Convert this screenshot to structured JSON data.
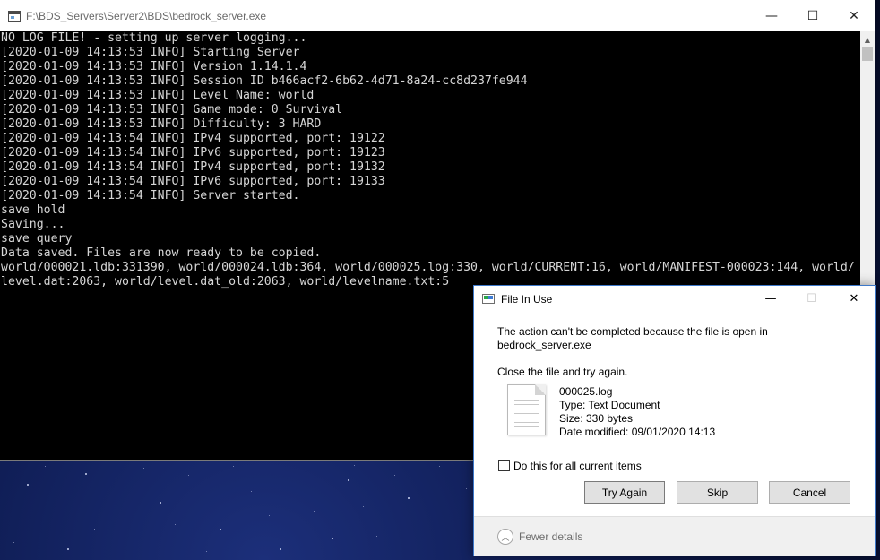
{
  "console": {
    "title": "F:\\BDS_Servers\\Server2\\BDS\\bedrock_server.exe",
    "lines": [
      "NO LOG FILE! - setting up server logging...",
      "[2020-01-09 14:13:53 INFO] Starting Server",
      "[2020-01-09 14:13:53 INFO] Version 1.14.1.4",
      "[2020-01-09 14:13:53 INFO] Session ID b466acf2-6b62-4d71-8a24-cc8d237fe944",
      "[2020-01-09 14:13:53 INFO] Level Name: world",
      "[2020-01-09 14:13:53 INFO] Game mode: 0 Survival",
      "[2020-01-09 14:13:53 INFO] Difficulty: 3 HARD",
      "[2020-01-09 14:13:54 INFO] IPv4 supported, port: 19122",
      "[2020-01-09 14:13:54 INFO] IPv6 supported, port: 19123",
      "[2020-01-09 14:13:54 INFO] IPv4 supported, port: 19132",
      "[2020-01-09 14:13:54 INFO] IPv6 supported, port: 19133",
      "[2020-01-09 14:13:54 INFO] Server started.",
      "save hold",
      "Saving...",
      "save query",
      "Data saved. Files are now ready to be copied.",
      "world/000021.ldb:331390, world/000024.ldb:364, world/000025.log:330, world/CURRENT:16, world/MANIFEST-000023:144, world/",
      "level.dat:2063, world/level.dat_old:2063, world/levelname.txt:5"
    ],
    "controls": {
      "minimize": "—",
      "maximize": "☐",
      "close": "✕"
    },
    "scrollbar": {
      "up": "▲",
      "down": "▼"
    }
  },
  "dialog": {
    "title": "File In Use",
    "controls": {
      "minimize": "—",
      "maximize": "☐",
      "close": "✕"
    },
    "message_line1": "The action can't be completed because the file is open in",
    "message_line2": "bedrock_server.exe",
    "instruction": "Close the file and try again.",
    "file": {
      "name": "000025.log",
      "type": "Type: Text Document",
      "size": "Size: 330 bytes",
      "date_modified": "Date modified: 09/01/2020 14:13"
    },
    "checkbox_label": "Do this for all current items",
    "checkbox_checked": false,
    "buttons": {
      "try_again": "Try Again",
      "skip": "Skip",
      "cancel": "Cancel"
    },
    "fewer_details": "Fewer details"
  },
  "colors": {
    "console_bg": "#000000",
    "console_text": "#d6d6d6",
    "dialog_border": "#3d78c9",
    "desktop_bg": "#0b1640"
  }
}
